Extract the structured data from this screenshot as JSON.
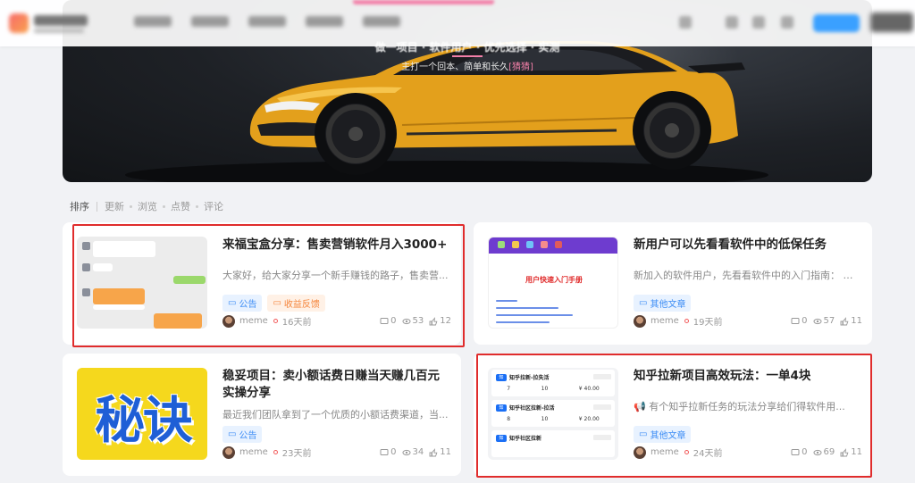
{
  "banner": {
    "title": "做一项目 · 软件用户 · 优先选择 · 实测",
    "subtitle_prefix": "主打一个回本、简单和长久",
    "subtitle_highlight": "[猜猜]"
  },
  "sort": {
    "label": "排序",
    "options": [
      "更新",
      "浏览",
      "点赞",
      "评论"
    ]
  },
  "cards": [
    {
      "title": "来福宝盒分享：售卖营销软件月入3000+",
      "excerpt": "大家好，给大家分享一个新手赚钱的路子，售卖营...",
      "tags": [
        "公告",
        "收益反馈"
      ],
      "author": "meme",
      "time": "16天前",
      "comments": "0",
      "views": "53",
      "likes": "12"
    },
    {
      "title": "新用户可以先看看软件中的低保任务",
      "excerpt": "新加入的软件用户，先看看软件中的入门指南： 然后...",
      "tags": [
        "其他文章"
      ],
      "author": "meme",
      "time": "19天前",
      "comments": "0",
      "views": "57",
      "likes": "11",
      "thumb_heading": "用户快速入门手册"
    },
    {
      "title": "稳妥项目：卖小额话费日赚当天赚几百元实操分享",
      "excerpt": "最近我们团队拿到了一个优质的小额话费渠道，当...",
      "tags": [
        "公告"
      ],
      "author": "meme",
      "time": "23天前",
      "comments": "0",
      "views": "34",
      "likes": "11",
      "thumb_text": "秘诀"
    },
    {
      "title": "知乎拉新项目高效玩法：一单4块",
      "excerpt": "有个知乎拉新任务的玩法分享给们得软件用...",
      "tags": [
        "其他文章"
      ],
      "author": "meme",
      "time": "24天前",
      "comments": "0",
      "views": "69",
      "likes": "11",
      "thumb_rows": [
        {
          "name": "知乎拉新-拉失活",
          "a": "7",
          "b": "10",
          "c": "¥ 40.00"
        },
        {
          "name": "知乎社区拉新-拉活",
          "a": "8",
          "b": "10",
          "c": "¥ 20.00"
        },
        {
          "name": "知乎社区拉新",
          "a": "",
          "b": "",
          "c": ""
        }
      ]
    }
  ],
  "colors": {
    "highlight_border": "#e02c2c",
    "tag_blue": "#3b8cf5",
    "tag_orange": "#f5853b",
    "car_yellow": "#e8a317"
  }
}
